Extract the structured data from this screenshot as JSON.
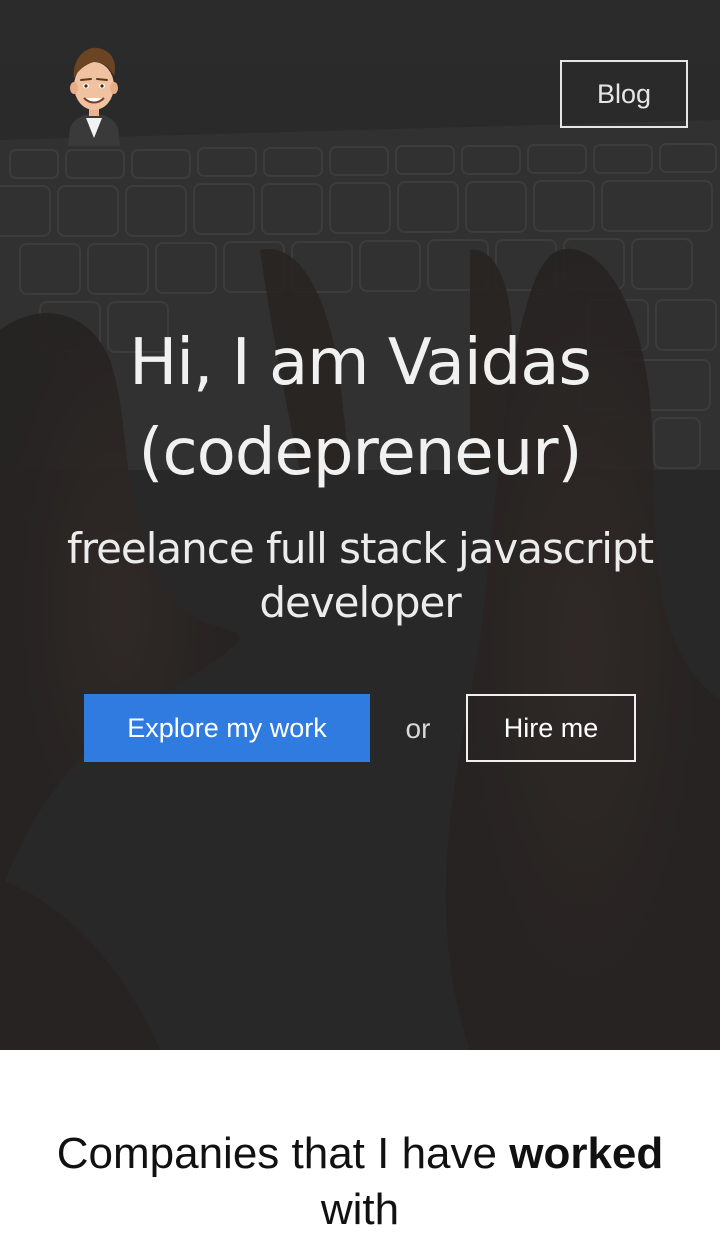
{
  "header": {
    "blog_label": "Blog"
  },
  "hero": {
    "title_line1": "Hi, I am Vaidas",
    "title_line2": "(codepreneur)",
    "subtitle": "freelance full stack javascript developer",
    "explore_label": "Explore my work",
    "or_label": "or",
    "hire_label": "Hire me"
  },
  "companies": {
    "title_prefix": "Companies that I have ",
    "title_bold": "worked",
    "title_suffix": " with"
  },
  "colors": {
    "accent": "#2f7be0",
    "hero_bg": "#2e2e2e",
    "hero_text": "#f1f1f1"
  },
  "icons": {
    "avatar": "cartoon-avatar-icon"
  }
}
